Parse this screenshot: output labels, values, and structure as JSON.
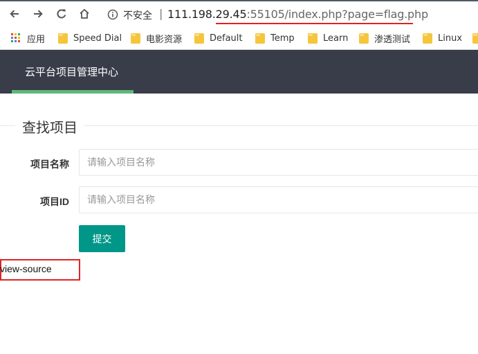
{
  "browser": {
    "security_label": "不安全",
    "separator": "|",
    "url_host": "111.198.29.45",
    "url_rest": ":55105/index.php?page=flag.php",
    "annotation_color": "#e21f1f",
    "bookmarks": [
      {
        "label": "应用",
        "icon": "apps-icon"
      },
      {
        "label": "Speed Dial",
        "icon": "folder-icon"
      },
      {
        "label": "电影资源",
        "icon": "folder-icon"
      },
      {
        "label": "Default",
        "icon": "folder-icon"
      },
      {
        "label": "Temp",
        "icon": "folder-icon"
      },
      {
        "label": "Learn",
        "icon": "folder-icon"
      },
      {
        "label": "渗透测试",
        "icon": "folder-icon"
      },
      {
        "label": "Linux",
        "icon": "folder-icon"
      }
    ]
  },
  "app": {
    "title": "云平台项目管理中心",
    "nav_color": "#393d49",
    "active_color": "#5fb878"
  },
  "search": {
    "legend": "查找项目",
    "name_label": "项目名称",
    "name_placeholder": "请输入项目名称",
    "id_label": "项目ID",
    "id_placeholder": "请输入项目名称",
    "submit_label": "提交",
    "submit_color": "#009688"
  },
  "source_hint": "view-source"
}
